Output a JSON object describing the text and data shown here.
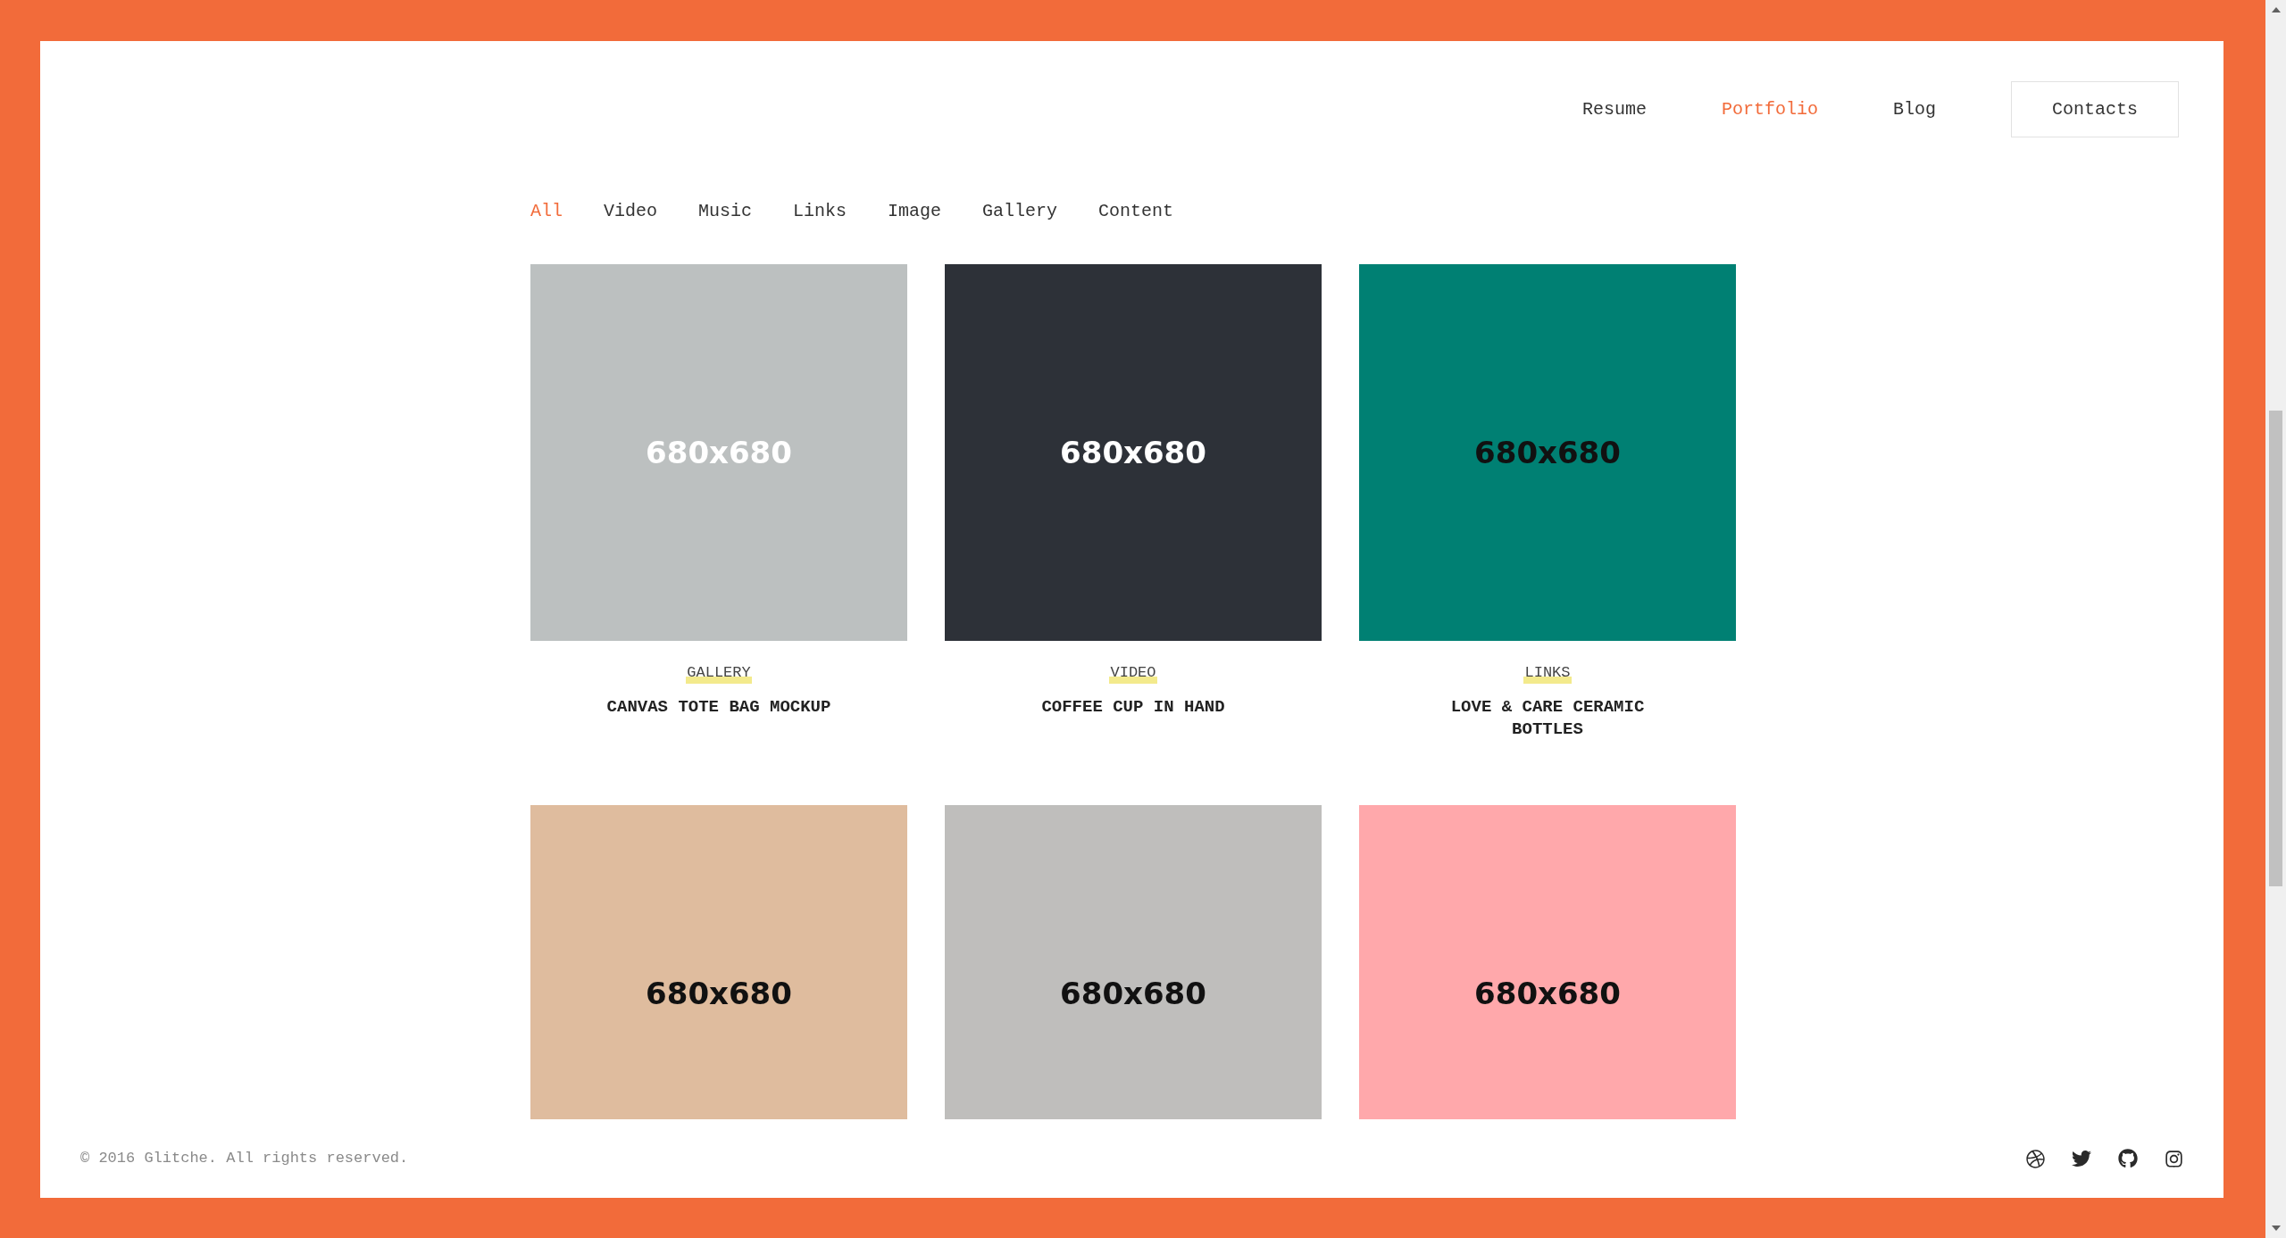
{
  "nav": [
    {
      "label": "Resume",
      "selected": false
    },
    {
      "label": "Portfolio",
      "selected": true
    },
    {
      "label": "Blog",
      "selected": false
    }
  ],
  "contacts_button": "Contacts",
  "filters": [
    {
      "label": "All",
      "selected": true
    },
    {
      "label": "Video",
      "selected": false
    },
    {
      "label": "Music",
      "selected": false
    },
    {
      "label": "Links",
      "selected": false
    },
    {
      "label": "Image",
      "selected": false
    },
    {
      "label": "Gallery",
      "selected": false
    },
    {
      "label": "Content",
      "selected": false
    }
  ],
  "cards": [
    {
      "placeholder": "680x680",
      "color": "#bcc0c0",
      "light_label": true,
      "category": "GALLERY",
      "title": "CANVAS TOTE BAG MOCKUP"
    },
    {
      "placeholder": "680x680",
      "color": "#2d3138",
      "light_label": true,
      "category": "VIDEO",
      "title": "COFFEE CUP IN HAND"
    },
    {
      "placeholder": "680x680",
      "color": "#008073",
      "light_label": false,
      "category": "LINKS",
      "title": "LOVE & CARE CERAMIC BOTTLES"
    },
    {
      "placeholder": "680x680",
      "color": "#dfbc9e",
      "light_label": false
    },
    {
      "placeholder": "680x680",
      "color": "#bfbebc",
      "light_label": false
    },
    {
      "placeholder": "680x680",
      "color": "#ffa8ab",
      "light_label": false
    }
  ],
  "footer": {
    "copyright": "© 2016 Glitche. All rights reserved."
  }
}
